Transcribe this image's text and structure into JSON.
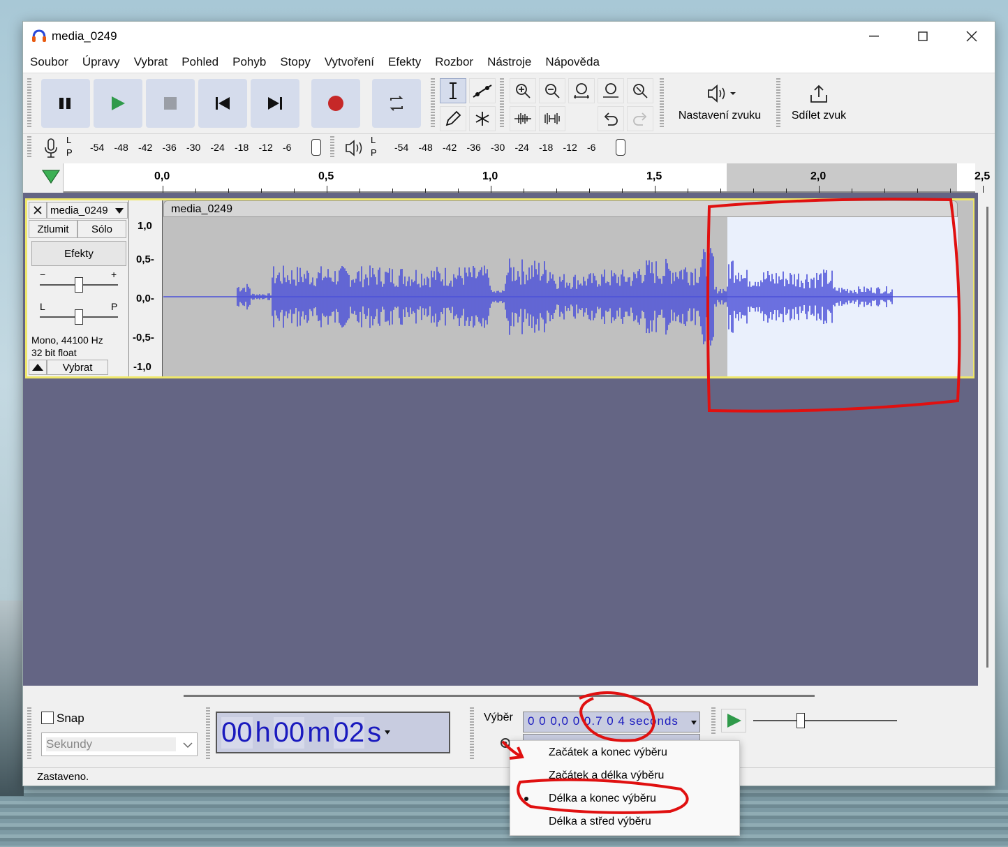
{
  "window": {
    "title": "media_0249"
  },
  "menu": [
    "Soubor",
    "Úpravy",
    "Vybrat",
    "Pohled",
    "Pohyb",
    "Stopy",
    "Vytvoření",
    "Efekty",
    "Rozbor",
    "Nástroje",
    "Nápověda"
  ],
  "toolbar": {
    "audio_setup": "Nastavení zvuku",
    "share": "Sdílet zvuk"
  },
  "meter": {
    "L": "L",
    "P": "P",
    "ticks": [
      "-54",
      "-48",
      "-42",
      "-36",
      "-30",
      "-24",
      "-18",
      "-12",
      "-6"
    ]
  },
  "ruler": {
    "ticks": [
      "0,0",
      "0,5",
      "1,0",
      "1,5",
      "2,0",
      "2,5"
    ]
  },
  "track": {
    "name": "media_0249",
    "mute": "Ztlumit",
    "solo": "Sólo",
    "effects": "Efekty",
    "gain_minus": "−",
    "gain_plus": "+",
    "pan_l": "L",
    "pan_r": "P",
    "info1": "Mono, 44100 Hz",
    "info2": "32 bit float",
    "select": "Vybrat",
    "clip_name": "media_0249",
    "scale": [
      "1,0",
      "0,5-",
      "0,0-",
      "-0,5-",
      "-1,0"
    ]
  },
  "bottom": {
    "snap": "Snap",
    "units": "Sekundy",
    "time": [
      "00",
      "h",
      "00",
      "m",
      "02",
      "s"
    ],
    "selection_label": "Výběr",
    "selection_value": "0 0 0,0 0 0.7 0 4 seconds"
  },
  "popup": {
    "items": [
      "Začátek a konec výběru",
      "Začátek a délka výběru",
      "Délka a konec výběru",
      "Délka a střed výběru"
    ],
    "selected_index": 2
  },
  "status": {
    "text": "Zastaveno."
  },
  "colors": {
    "waveform": "#4b50d8",
    "selection": "#eaf0fc",
    "annotation": "#e01010",
    "track_bg": "#646584"
  }
}
